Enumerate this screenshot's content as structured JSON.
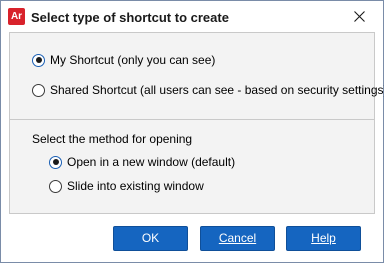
{
  "window": {
    "title": "Select type of shortcut to create",
    "app_icon_text": "Ar"
  },
  "shortcut_type": {
    "options": [
      {
        "label": "My Shortcut (only you can see)",
        "checked": true
      },
      {
        "label": "Shared Shortcut (all users can see - based on security settings)",
        "checked": false
      }
    ]
  },
  "open_method": {
    "heading": "Select the method for opening",
    "options": [
      {
        "label": "Open in a new window (default)",
        "checked": true
      },
      {
        "label": "Slide into existing window",
        "checked": false
      }
    ]
  },
  "buttons": {
    "ok": "OK",
    "cancel": "Cancel",
    "help": "Help"
  },
  "colors": {
    "accent": "#1565c0",
    "app_icon": "#d8222b"
  },
  "icons": {
    "app": "app-logo-icon",
    "close": "close-icon"
  }
}
